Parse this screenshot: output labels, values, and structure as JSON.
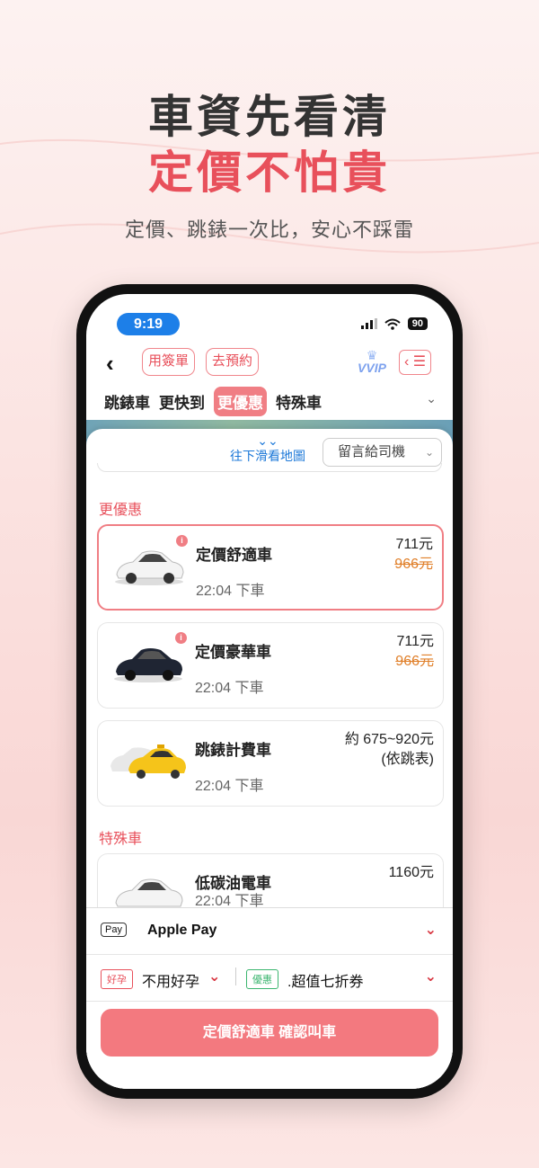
{
  "headline": {
    "line1": "車資先看清",
    "line2": "定價不怕貴",
    "subtitle": "定價、跳錶一次比，安心不踩雷"
  },
  "status_bar": {
    "time": "9:19",
    "battery": "90"
  },
  "nav": {
    "back": "‹",
    "use_voucher": "用簽單",
    "reserve": "去預約",
    "vip_label": "VVIP",
    "menu": "‹ ☰"
  },
  "tabs": [
    "跳錶車",
    "更快到",
    "更優惠",
    "特殊車"
  ],
  "active_tab": "更優惠",
  "sheet": {
    "scroll_hint": "往下滑看地圖",
    "message_select": "留言給司機"
  },
  "sections": {
    "cheaper": "更優惠",
    "special": "特殊車"
  },
  "cars": [
    {
      "name": "定價舒適車",
      "time": "22:04 下車",
      "price": "711元",
      "original_price": "966元",
      "selected": true
    },
    {
      "name": "定價豪華車",
      "time": "22:04 下車",
      "price": "711元",
      "original_price": "966元",
      "selected": false
    },
    {
      "name": "跳錶計費車",
      "time": "22:04 下車",
      "price": "約 675~920元",
      "price_note": "(依跳表)",
      "selected": false
    },
    {
      "name": "低碳油電車",
      "time": "22:04 下車",
      "price": "1160元",
      "selected": false
    }
  ],
  "payment": {
    "method_icon": "Pay",
    "method": "Apple Pay",
    "ride_tag": "好孕",
    "ride_option": "不用好孕",
    "coupon_tag": "優惠",
    "coupon": ".超值七折券"
  },
  "confirm_button": "定價舒適車 確認叫車",
  "colors": {
    "accent": "#e8505b",
    "button": "#f3797f",
    "link": "#1c78d8"
  }
}
